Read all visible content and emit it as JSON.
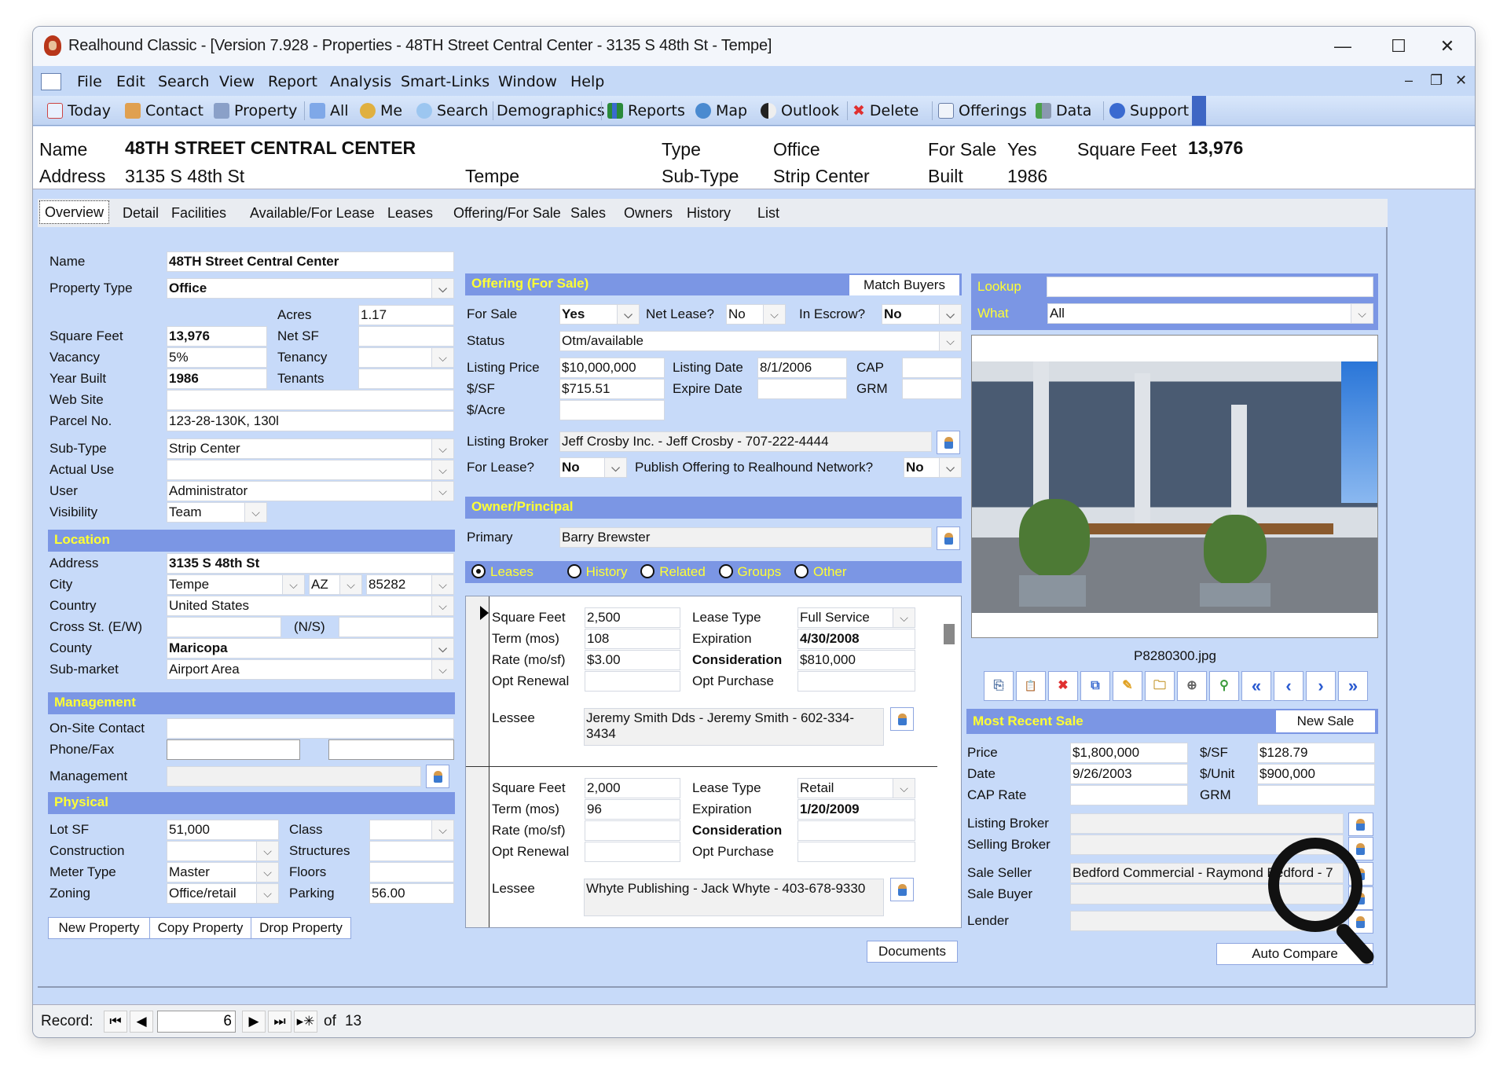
{
  "window": {
    "title": "Realhound Classic - [Version 7.928 - Properties - 48TH Street Central Center - 3135 S 48th St - Tempe]",
    "controls": {
      "minimize": "—",
      "maximize": "☐",
      "close": "✕"
    },
    "mdi_controls": {
      "minimize": "–",
      "restore": "❐",
      "close": "✕"
    }
  },
  "menu": [
    "File",
    "Edit",
    "Search",
    "View",
    "Report",
    "Analysis",
    "Smart-Links",
    "Window",
    "Help"
  ],
  "toolbar": [
    {
      "label": "Today",
      "icon": "calendar-icon"
    },
    {
      "label": "Contact",
      "icon": "contacts-icon"
    },
    {
      "label": "Property",
      "icon": "building-icon"
    },
    {
      "label": "All",
      "icon": "all-icon"
    },
    {
      "label": "Me",
      "icon": "person-icon"
    },
    {
      "label": "Search",
      "icon": "search-icon"
    },
    {
      "label": "Demographics",
      "icon": ""
    },
    {
      "label": "Reports",
      "icon": "chart-icon"
    },
    {
      "label": "Map",
      "icon": "globe-icon"
    },
    {
      "label": "Outlook",
      "icon": "yin-yang-icon"
    },
    {
      "label": "Delete",
      "icon": "delete-icon"
    },
    {
      "label": "Offerings",
      "icon": "list-icon"
    },
    {
      "label": "Data",
      "icon": "data-icon"
    },
    {
      "label": "Support",
      "icon": "help-icon"
    }
  ],
  "header": {
    "name_label": "Name",
    "name": "48TH STREET CENTRAL CENTER",
    "address_label": "Address",
    "address": "3135 S 48th St",
    "city": "Tempe",
    "type_label": "Type",
    "type": "Office",
    "subtype_label": "Sub-Type",
    "subtype": "Strip Center",
    "forsale_label": "For Sale",
    "forsale": "Yes",
    "built_label": "Built",
    "built": "1986",
    "sqft_label": "Square Feet",
    "sqft": "13,976"
  },
  "tabs": [
    "Overview",
    "Detail",
    "Facilities",
    "Available/For Lease",
    "Leases",
    "Offering/For Sale",
    "Sales",
    "Owners",
    "History",
    "List"
  ],
  "general": {
    "name_label": "Name",
    "name": "48TH Street Central Center",
    "ptype_label": "Property Type",
    "ptype": "Office",
    "acres_label": "Acres",
    "acres": "1.17",
    "sqft_label": "Square Feet",
    "sqft": "13,976",
    "netsf_label": "Net SF",
    "netsf": "",
    "vacancy_label": "Vacancy",
    "vacancy": "5%",
    "tenancy_label": "Tenancy",
    "tenancy": "",
    "year_label": "Year Built",
    "year": "1986",
    "tenants_label": "Tenants",
    "tenants": "",
    "web_label": "Web Site",
    "web": "",
    "parcel_label": "Parcel No.",
    "parcel": "123-28-130K, 130l",
    "subtype_label": "Sub-Type",
    "subtype": "Strip Center",
    "actual_label": "Actual Use",
    "actual": "",
    "user_label": "User",
    "user": "Administrator",
    "vis_label": "Visibility",
    "vis": "Team"
  },
  "location": {
    "title": "Location",
    "address_label": "Address",
    "address": "3135 S 48th St",
    "city_label": "City",
    "city": "Tempe",
    "state": "AZ",
    "zip": "85282",
    "country_label": "Country",
    "country": "United States",
    "cross_label": "Cross St. (E/W)",
    "cross_ew": "",
    "ns_label": "(N/S)",
    "cross_ns": "",
    "county_label": "County",
    "county": "Maricopa",
    "submarket_label": "Sub-market",
    "submarket": "Airport Area"
  },
  "management": {
    "title": "Management",
    "onsite_label": "On-Site Contact",
    "onsite": "",
    "phone_label": "Phone/Fax",
    "phone": "",
    "fax": "",
    "mgmt_label": "Management",
    "mgmt": ""
  },
  "physical": {
    "title": "Physical",
    "lotsf_label": "Lot SF",
    "lotsf": "51,000",
    "class_label": "Class",
    "class": "",
    "construction_label": "Construction",
    "construction": "",
    "structures_label": "Structures",
    "structures": "",
    "meter_label": "Meter Type",
    "meter": "Master",
    "floors_label": "Floors",
    "floors": "",
    "zoning_label": "Zoning",
    "zoning": "Office/retail",
    "parking_label": "Parking",
    "parking": "56.00"
  },
  "property_buttons": [
    "New Property",
    "Copy Property",
    "Drop Property"
  ],
  "offering": {
    "title": "Offering (For Sale)",
    "match_buyers": "Match Buyers",
    "forsale_label": "For Sale",
    "forsale": "Yes",
    "netlease_label": "Net Lease?",
    "netlease": "No",
    "escrow_label": "In Escrow?",
    "escrow": "No",
    "status_label": "Status",
    "status": "Otm/available",
    "price_label": "Listing Price",
    "price": "$10,000,000",
    "ldate_label": "Listing Date",
    "ldate": "8/1/2006",
    "cap_label": "CAP",
    "cap": "",
    "psf_label": "$/SF",
    "psf": "$715.51",
    "edate_label": "Expire Date",
    "edate": "",
    "grm_label": "GRM",
    "grm": "",
    "pacre_label": "$/Acre",
    "pacre": "",
    "broker_label": "Listing Broker",
    "broker": "Jeff Crosby Inc. - Jeff Crosby - 707-222-4444",
    "forlease_label": "For Lease?",
    "forlease": "No",
    "publish_label": "Publish Offering to Realhound Network?",
    "publish": "No"
  },
  "owner": {
    "title": "Owner/Principal",
    "primary_label": "Primary",
    "primary": "Barry Brewster"
  },
  "sub_tabs": {
    "options": [
      "Leases",
      "History",
      "Related",
      "Groups",
      "Other"
    ],
    "selected": "Leases"
  },
  "leases": [
    {
      "sqft": "2,500",
      "term": "108",
      "rate": "$3.00",
      "renewal": "",
      "type": "Full Service",
      "expiration": "4/30/2008",
      "consideration": "$810,000",
      "purchase": "",
      "lessee": "Jeremy Smith Dds - Jeremy Smith - 602-334-3434"
    },
    {
      "sqft": "2,000",
      "term": "96",
      "rate": "",
      "renewal": "",
      "type": "Retail",
      "expiration": "1/20/2009",
      "consideration": "",
      "purchase": "",
      "lessee": "Whyte Publishing - Jack Whyte - 403-678-9330"
    }
  ],
  "lease_labels": {
    "sqft": "Square Feet",
    "term": "Term (mos)",
    "rate": "Rate (mo/sf)",
    "renewal": "Opt Renewal",
    "type": "Lease Type",
    "expiration": "Expiration",
    "consideration": "Consideration",
    "purchase": "Opt Purchase",
    "lessee": "Lessee"
  },
  "documents_button": "Documents",
  "lookup": {
    "lookup_label": "Lookup",
    "lookup": "",
    "what_label": "What",
    "what": "All"
  },
  "photo": {
    "filename": "P8280300.jpg"
  },
  "photo_tools": [
    "copy-icon",
    "paste-icon",
    "delete-icon",
    "network-icon",
    "clear-icon",
    "folder-icon",
    "zoom-icon",
    "pin-icon",
    "first-icon",
    "prev-icon",
    "next-icon",
    "last-icon"
  ],
  "photo_tool_glyphs": [
    "⎘",
    "📋",
    "✖",
    "⧉",
    "✎",
    "🗀",
    "⊕",
    "⚲",
    "«",
    "‹",
    "›",
    "»"
  ],
  "sale": {
    "title": "Most Recent Sale",
    "new_sale": "New Sale",
    "price_label": "Price",
    "price": "$1,800,000",
    "psf_label": "$/SF",
    "psf": "$128.79",
    "date_label": "Date",
    "date": "9/26/2003",
    "punit_label": "$/Unit",
    "punit": "$900,000",
    "cap_label": "CAP Rate",
    "cap": "",
    "grm_label": "GRM",
    "grm": "",
    "lbroker_label": "Listing Broker",
    "lbroker": "",
    "sbroker_label": "Selling Broker",
    "sbroker": "",
    "seller_label": "Sale Seller",
    "seller": "Bedford Commercial - Raymond Bedford - 7",
    "buyer_label": "Sale Buyer",
    "buyer": "",
    "lender_label": "Lender",
    "lender": "",
    "auto_compare": "Auto Compare"
  },
  "record": {
    "label": "Record:",
    "current": "6",
    "of_label": "of",
    "total": "13"
  },
  "colors": {
    "section": "#7b96e4",
    "section_text": "#ffff33",
    "background": "#c7daf9"
  }
}
